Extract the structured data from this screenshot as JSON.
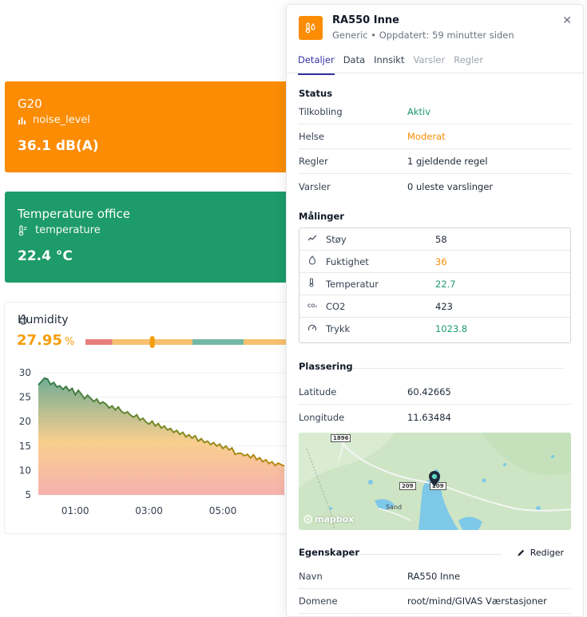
{
  "cards": [
    {
      "title": "G20",
      "metric": "noise_level",
      "metric_icon": "bar-chart-icon",
      "value": "36.1 dB(A)",
      "color": "#fb8c04"
    },
    {
      "title": "Temperature office",
      "metric": "temperature",
      "metric_icon": "thermometer-icon",
      "value": "22.4 °C",
      "color": "#1d9b69"
    }
  ],
  "humidity": {
    "title": "Humidity",
    "icon": "droplet-icon",
    "value": "27.95",
    "unit": "%",
    "level_fraction": 0.3,
    "bar_colors": [
      "#e87d7d",
      "#f8bf6e",
      "#72b8a4"
    ]
  },
  "chart_data": {
    "type": "area",
    "xlabel": "",
    "ylabel": "",
    "ylim": [
      5,
      30
    ],
    "yticks": [
      30,
      25,
      20,
      15,
      10,
      5
    ],
    "xticks": [
      "01:00",
      "03:00",
      "05:00"
    ],
    "grid": true,
    "x": [
      "00:00",
      "00:05",
      "00:10",
      "00:15",
      "00:20",
      "00:25",
      "00:30",
      "00:35",
      "00:40",
      "00:45",
      "00:50",
      "00:55",
      "01:00",
      "01:05",
      "01:10",
      "01:15",
      "01:20",
      "01:25",
      "01:30",
      "01:35",
      "01:40",
      "01:45",
      "01:50",
      "01:55",
      "02:00",
      "02:05",
      "02:10",
      "02:15",
      "02:20",
      "02:25",
      "02:30",
      "02:35",
      "02:40",
      "02:45",
      "02:50",
      "02:55",
      "03:00",
      "03:05",
      "03:10",
      "03:15",
      "03:20",
      "03:25",
      "03:30",
      "03:35",
      "03:40",
      "03:45",
      "03:50",
      "03:55",
      "04:00",
      "04:05",
      "04:10",
      "04:15",
      "04:20",
      "04:25",
      "04:30",
      "04:35",
      "04:40",
      "04:45",
      "04:50",
      "04:55",
      "05:00",
      "05:05",
      "05:10",
      "05:15",
      "05:20",
      "05:25",
      "05:30",
      "05:35",
      "05:40",
      "05:45",
      "05:50",
      "05:55",
      "06:00",
      "06:05",
      "06:10",
      "06:15",
      "06:20",
      "06:25",
      "06:30",
      "06:35",
      "06:40"
    ],
    "values": [
      27.5,
      28.2,
      28.9,
      28.7,
      27.6,
      28.0,
      27.1,
      27.3,
      26.6,
      27.2,
      26.3,
      26.8,
      25.5,
      26.4,
      25.6,
      24.7,
      25.4,
      24.8,
      24.1,
      24.6,
      23.7,
      24.0,
      23.6,
      22.8,
      23.2,
      22.4,
      23.0,
      22.1,
      21.7,
      22.0,
      21.3,
      20.9,
      21.4,
      20.3,
      20.7,
      19.9,
      19.5,
      20.1,
      19.1,
      19.6,
      18.7,
      19.1,
      18.3,
      18.6,
      17.8,
      18.2,
      17.4,
      17.8,
      16.9,
      17.3,
      16.6,
      17.1,
      16.0,
      16.5,
      15.7,
      16.0,
      15.3,
      15.7,
      15.0,
      15.4,
      14.5,
      15.0,
      14.2,
      14.6,
      13.3,
      13.5,
      13.5,
      13.0,
      13.3,
      12.6,
      13.2,
      12.2,
      12.6,
      11.8,
      12.2,
      11.4,
      11.8,
      11.0,
      11.5,
      11.2,
      10.9
    ]
  },
  "panel": {
    "title": "RA550 Inne",
    "subtitle": "Generic • Oppdatert: 59 minutter siden",
    "logo_icon": "sensor-icon",
    "close": "✕",
    "tabs": [
      "Detaljer",
      "Data",
      "Innsikt",
      "Varsler",
      "Regler"
    ],
    "status": {
      "heading": "Status",
      "rows": [
        {
          "label": "Tilkobling",
          "value": "Aktiv"
        },
        {
          "label": "Helse",
          "value": "Moderat"
        },
        {
          "label": "Regler",
          "value": "1 gjeldende regel"
        },
        {
          "label": "Varsler",
          "value": "0 uleste varslinger"
        }
      ]
    },
    "measurements": {
      "heading": "Målinger",
      "rows": [
        {
          "icon": "trend-icon",
          "label": "Støy",
          "value": "58"
        },
        {
          "icon": "droplet-icon",
          "label": "Fuktighet",
          "value": "36"
        },
        {
          "icon": "thermometer-icon",
          "label": "Temperatur",
          "value": "22.7"
        },
        {
          "icon": "co2-icon",
          "label": "CO2",
          "value": "423"
        },
        {
          "icon": "gauge-icon",
          "label": "Trykk",
          "value": "1023.8"
        }
      ]
    },
    "location": {
      "heading": "Plassering",
      "rows": [
        {
          "label": "Latitude",
          "value": "60.42665"
        },
        {
          "label": "Longitude",
          "value": "11.63484"
        }
      ],
      "map": {
        "roads": [
          "1896",
          "209",
          "209"
        ],
        "place": "Sand",
        "attribution": "mapbox"
      }
    },
    "properties": {
      "heading": "Egenskaper",
      "edit_label": "Rediger",
      "rows": [
        {
          "label": "Navn",
          "value": "RA550 Inne"
        },
        {
          "label": "Domene",
          "value": "root/mind/GIVAS Værstasjoner"
        }
      ]
    }
  }
}
